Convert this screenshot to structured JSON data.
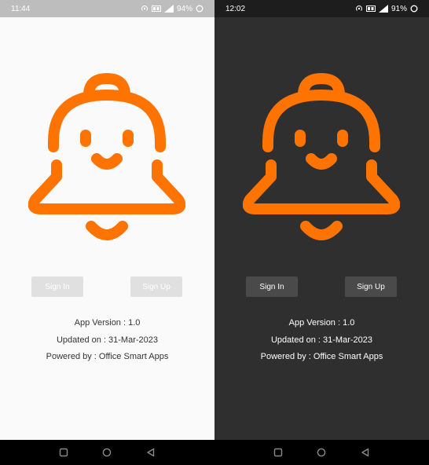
{
  "screens": {
    "light": {
      "status": {
        "time": "11:44",
        "battery": "94%"
      },
      "buttons": {
        "sign_in": "Sign In",
        "sign_up": "Sign Up"
      },
      "info": {
        "version": "App Version : 1.0",
        "updated": "Updated on : 31-Mar-2023",
        "powered": "Powered by : Office Smart Apps"
      }
    },
    "dark": {
      "status": {
        "time": "12:02",
        "battery": "91%"
      },
      "buttons": {
        "sign_in": "Sign In",
        "sign_up": "Sign Up"
      },
      "info": {
        "version": "App Version : 1.0",
        "updated": "Updated on : 31-Mar-2023",
        "powered": "Powered by : Office Smart Apps"
      }
    }
  },
  "icons": {
    "logo": "bell-face-icon",
    "status": [
      "hotspot-icon",
      "volte-icon",
      "signal-icon",
      "battery-ring-icon"
    ],
    "nav": [
      "recents-square-icon",
      "home-circle-icon",
      "back-triangle-icon"
    ]
  },
  "colors": {
    "accent": "#ff7300",
    "light_background": "#fafafa",
    "dark_background": "#2f2f2f",
    "light_button": "#e0e0e0",
    "dark_button": "#4a4a4a"
  }
}
